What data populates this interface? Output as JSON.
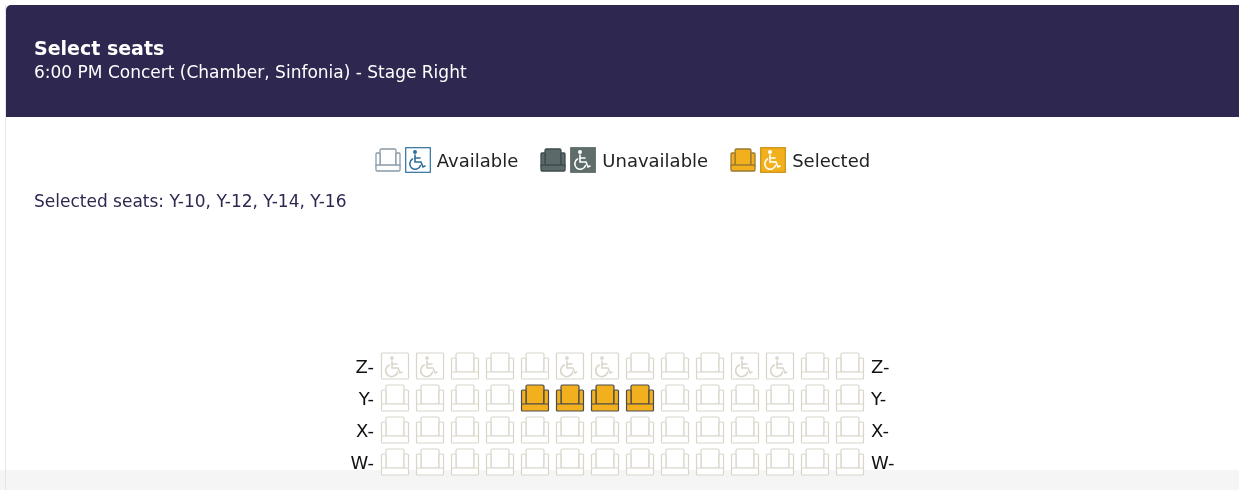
{
  "header": {
    "title": "Select seats",
    "subtitle": "6:00 PM Concert (Chamber, Sinfonia) - Stage Right"
  },
  "legend": [
    {
      "kind": "available",
      "label": "Available"
    },
    {
      "kind": "unavailable",
      "label": "Unavailable"
    },
    {
      "kind": "selected",
      "label": "Selected"
    }
  ],
  "selected_seats_text": "Selected seats: Y-10, Y-12, Y-14, Y-16",
  "rows": [
    {
      "label_left": "Z-",
      "label_right": "Z-",
      "seats": [
        {
          "kind": "wheelchair",
          "selected": false
        },
        {
          "kind": "wheelchair",
          "selected": false
        },
        {
          "kind": "seat",
          "selected": false
        },
        {
          "kind": "seat",
          "selected": false
        },
        {
          "kind": "seat",
          "selected": false
        },
        {
          "kind": "wheelchair",
          "selected": false
        },
        {
          "kind": "wheelchair",
          "selected": false
        },
        {
          "kind": "seat",
          "selected": false
        },
        {
          "kind": "seat",
          "selected": false
        },
        {
          "kind": "seat",
          "selected": false
        },
        {
          "kind": "wheelchair",
          "selected": false
        },
        {
          "kind": "wheelchair",
          "selected": false
        },
        {
          "kind": "seat",
          "selected": false
        },
        {
          "kind": "seat",
          "selected": false
        }
      ]
    },
    {
      "label_left": "Y-",
      "label_right": "Y-",
      "seats": [
        {
          "kind": "seat",
          "selected": false
        },
        {
          "kind": "seat",
          "selected": false
        },
        {
          "kind": "seat",
          "selected": false
        },
        {
          "kind": "seat",
          "selected": false
        },
        {
          "kind": "seat",
          "selected": true
        },
        {
          "kind": "seat",
          "selected": true
        },
        {
          "kind": "seat",
          "selected": true
        },
        {
          "kind": "seat",
          "selected": true
        },
        {
          "kind": "seat",
          "selected": false
        },
        {
          "kind": "seat",
          "selected": false
        },
        {
          "kind": "seat",
          "selected": false
        },
        {
          "kind": "seat",
          "selected": false
        },
        {
          "kind": "seat",
          "selected": false
        },
        {
          "kind": "seat",
          "selected": false
        }
      ]
    },
    {
      "label_left": "X-",
      "label_right": "X-",
      "seats": [
        {
          "kind": "seat",
          "selected": false
        },
        {
          "kind": "seat",
          "selected": false
        },
        {
          "kind": "seat",
          "selected": false
        },
        {
          "kind": "seat",
          "selected": false
        },
        {
          "kind": "seat",
          "selected": false
        },
        {
          "kind": "seat",
          "selected": false
        },
        {
          "kind": "seat",
          "selected": false
        },
        {
          "kind": "seat",
          "selected": false
        },
        {
          "kind": "seat",
          "selected": false
        },
        {
          "kind": "seat",
          "selected": false
        },
        {
          "kind": "seat",
          "selected": false
        },
        {
          "kind": "seat",
          "selected": false
        },
        {
          "kind": "seat",
          "selected": false
        },
        {
          "kind": "seat",
          "selected": false
        }
      ]
    },
    {
      "label_left": "W-",
      "label_right": "W-",
      "seats": [
        {
          "kind": "seat",
          "selected": false
        },
        {
          "kind": "seat",
          "selected": false
        },
        {
          "kind": "seat",
          "selected": false
        },
        {
          "kind": "seat",
          "selected": false
        },
        {
          "kind": "seat",
          "selected": false
        },
        {
          "kind": "seat",
          "selected": false
        },
        {
          "kind": "seat",
          "selected": false
        },
        {
          "kind": "seat",
          "selected": false
        },
        {
          "kind": "seat",
          "selected": false
        },
        {
          "kind": "seat",
          "selected": false
        },
        {
          "kind": "seat",
          "selected": false
        },
        {
          "kind": "seat",
          "selected": false
        },
        {
          "kind": "seat",
          "selected": false
        },
        {
          "kind": "seat",
          "selected": false
        }
      ]
    }
  ]
}
